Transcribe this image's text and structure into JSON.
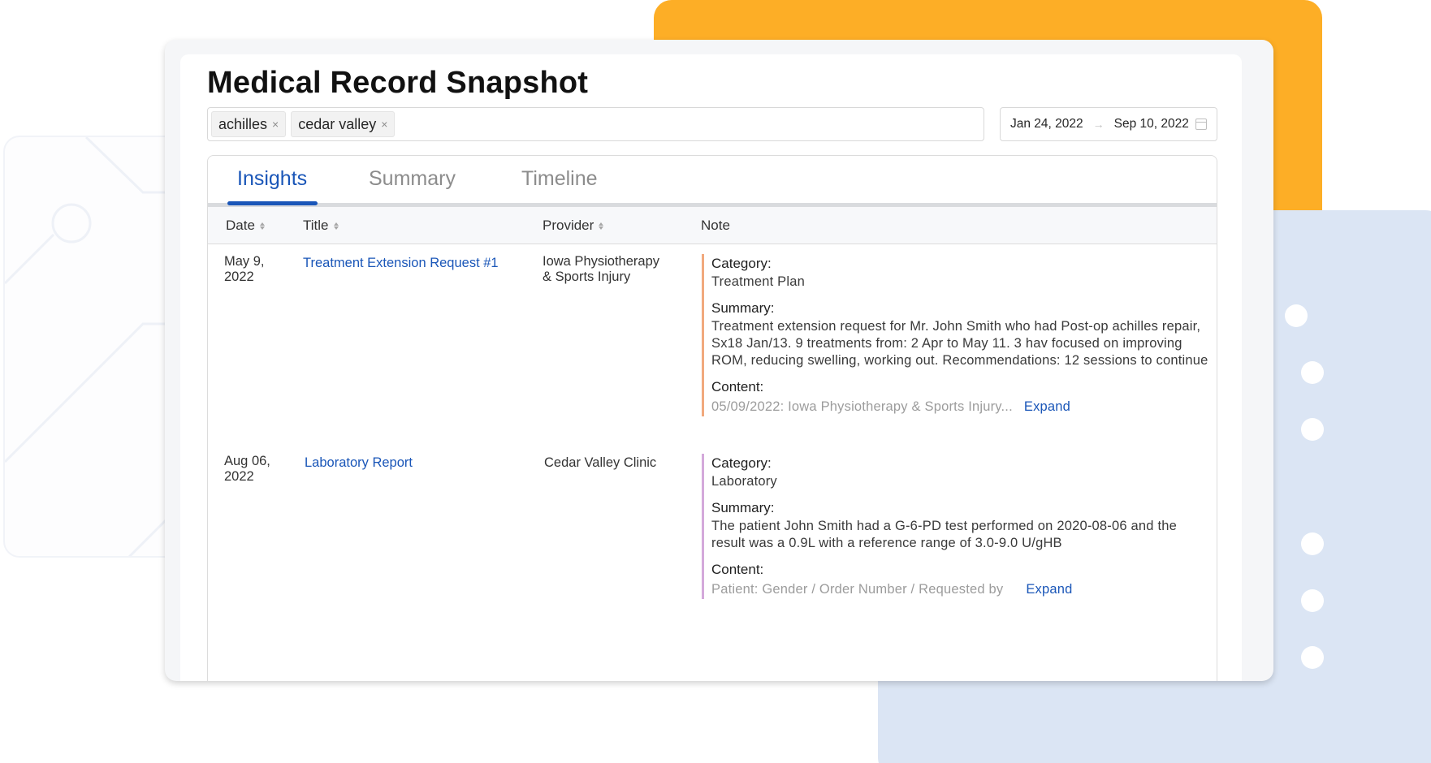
{
  "page_title": "Medical Record Snapshot",
  "filters": {
    "tags": [
      {
        "label": "achilles"
      },
      {
        "label": "cedar valley"
      }
    ],
    "remove_glyph": "×",
    "date_start": "Jan 24, 2022",
    "date_arrow": "→",
    "date_end": "Sep 10, 2022"
  },
  "tabs": [
    {
      "label": "Insights",
      "active": true
    },
    {
      "label": "Summary",
      "active": false
    },
    {
      "label": "Timeline",
      "active": false
    }
  ],
  "table": {
    "columns": [
      "Date",
      "Title",
      "Provider",
      "Note"
    ],
    "rows": [
      {
        "date_line1": "May 9,",
        "date_line2": "2022",
        "title": "Treatment Extension Request #1",
        "provider_line1": "Iowa Physiotherapy",
        "provider_line2": "& Sports Injury",
        "category_label": "Category:",
        "category": "Treatment Plan",
        "summary_label": "Summary:",
        "summary": "Treatment extension request for Mr. John Smith who had Post-op achilles repair, Sx18 Jan/13. 9 treatments from: 2 Apr to May 11. 3 hav focused on improving ROM, reducing swelling, working out. Recommendations: 12 sessions to continue",
        "content_label": "Content:",
        "content_preview": "05/09/2022:  Iowa Physiotherapy & Sports Injury...",
        "expand_label": "Expand"
      },
      {
        "date_line1": "Aug 06,",
        "date_line2": "2022",
        "title": "Laboratory Report",
        "provider_line1": "Cedar Valley Clinic",
        "category_label": "Category:",
        "category": "Laboratory",
        "summary_label": "Summary:",
        "summary": "The patient John Smith had a G-6-PD test performed on 2020-08-06 and the result was a 0.9L with a reference range of 3.0-9.0 U/gHB",
        "content_label": "Content:",
        "content_preview": "Patient: Gender / Order Number / Requested by",
        "expand_label": "Expand"
      }
    ]
  },
  "colors": {
    "accent": "#1a56b8",
    "background_orange": "#fdae26",
    "background_blue": "#dbe5f4",
    "note_bar_treatment": "#f1a97d",
    "note_bar_laboratory": "#d4a9db"
  }
}
